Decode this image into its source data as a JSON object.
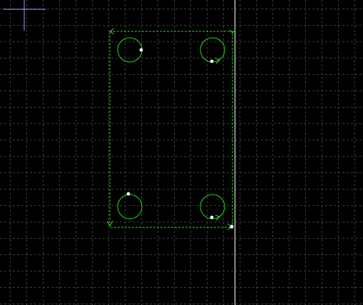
{
  "viewport": {
    "background_color": "#000000",
    "grid_color": "#3c3c3c",
    "show_grid": true,
    "grid_style": "dotted"
  },
  "crosshair": {
    "color": "#a0a0ff"
  },
  "guide_line": {
    "orientation": "vertical",
    "color": "#ffffff"
  },
  "toolpath": {
    "color": "#22dd22",
    "outline_style": "dashed",
    "direction_markers": "arrows",
    "hole_count": 4,
    "holes": [
      {
        "id": "hole-top-left"
      },
      {
        "id": "hole-top-right"
      },
      {
        "id": "hole-bottom-left"
      },
      {
        "id": "hole-bottom-right"
      }
    ]
  },
  "point_marker_color": "#ffffff"
}
